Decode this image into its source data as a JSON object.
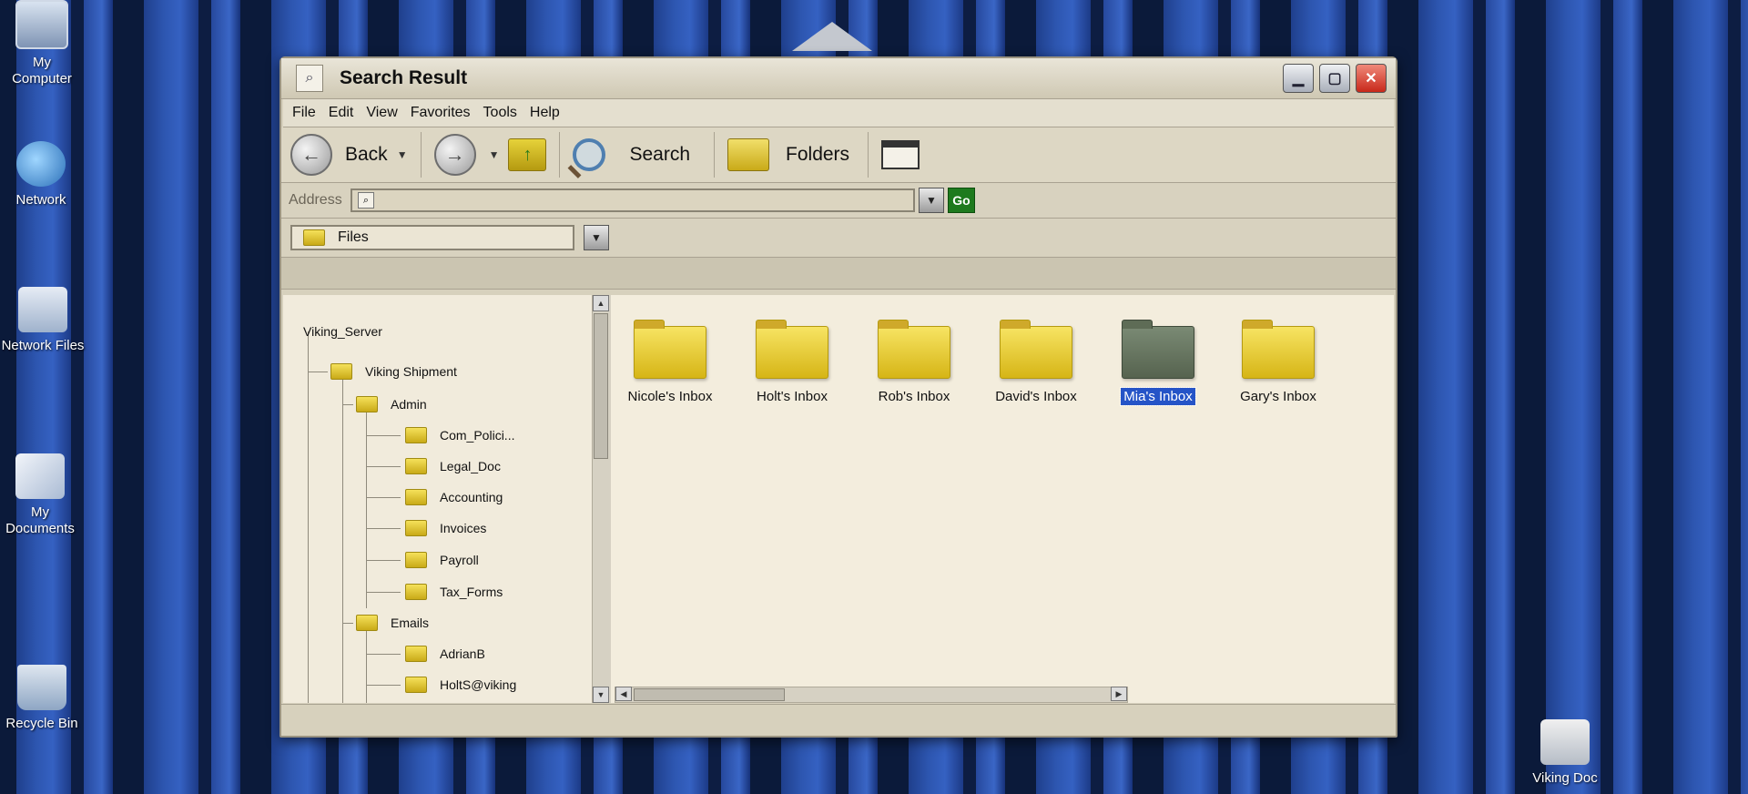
{
  "desktop": {
    "icons": [
      {
        "label_1": "My",
        "label_2": "Computer"
      },
      {
        "label_1": "Network"
      },
      {
        "label_1": "Network Files"
      },
      {
        "label_1": "My",
        "label_2": "Documents"
      },
      {
        "label_1": "Recycle Bin"
      },
      {
        "label_1": "Viking Doc"
      }
    ]
  },
  "window": {
    "title": "Search Result",
    "menu": [
      "File",
      "Edit",
      "View",
      "Favorites",
      "Tools",
      "Help"
    ],
    "toolbar": {
      "back_label": "Back",
      "search_label": "Search",
      "folders_label": "Folders"
    },
    "address": {
      "label": "Address",
      "value": "",
      "go_label": "Go"
    },
    "location": "Files",
    "tree": {
      "root": "Viking_Server",
      "level1": "Viking Shipment",
      "admin": "Admin",
      "admin_children": [
        "Com_Polici...",
        "Legal_Doc",
        "Accounting",
        "Invoices",
        "Payroll",
        "Tax_Forms"
      ],
      "emails": "Emails",
      "email_children": [
        "AdrianB",
        "HoltS@viking"
      ]
    },
    "files": [
      {
        "name": "Nicole's Inbox",
        "selected": false
      },
      {
        "name": "Holt's Inbox",
        "selected": false
      },
      {
        "name": "Rob's Inbox",
        "selected": false
      },
      {
        "name": "David's Inbox",
        "selected": false
      },
      {
        "name": "Mia's Inbox",
        "selected": true
      },
      {
        "name": "Gary's Inbox",
        "selected": false
      }
    ],
    "colors": {
      "selection": "#2554c7",
      "folder": "#e8cc2a",
      "selected_folder": "#56634f"
    }
  }
}
